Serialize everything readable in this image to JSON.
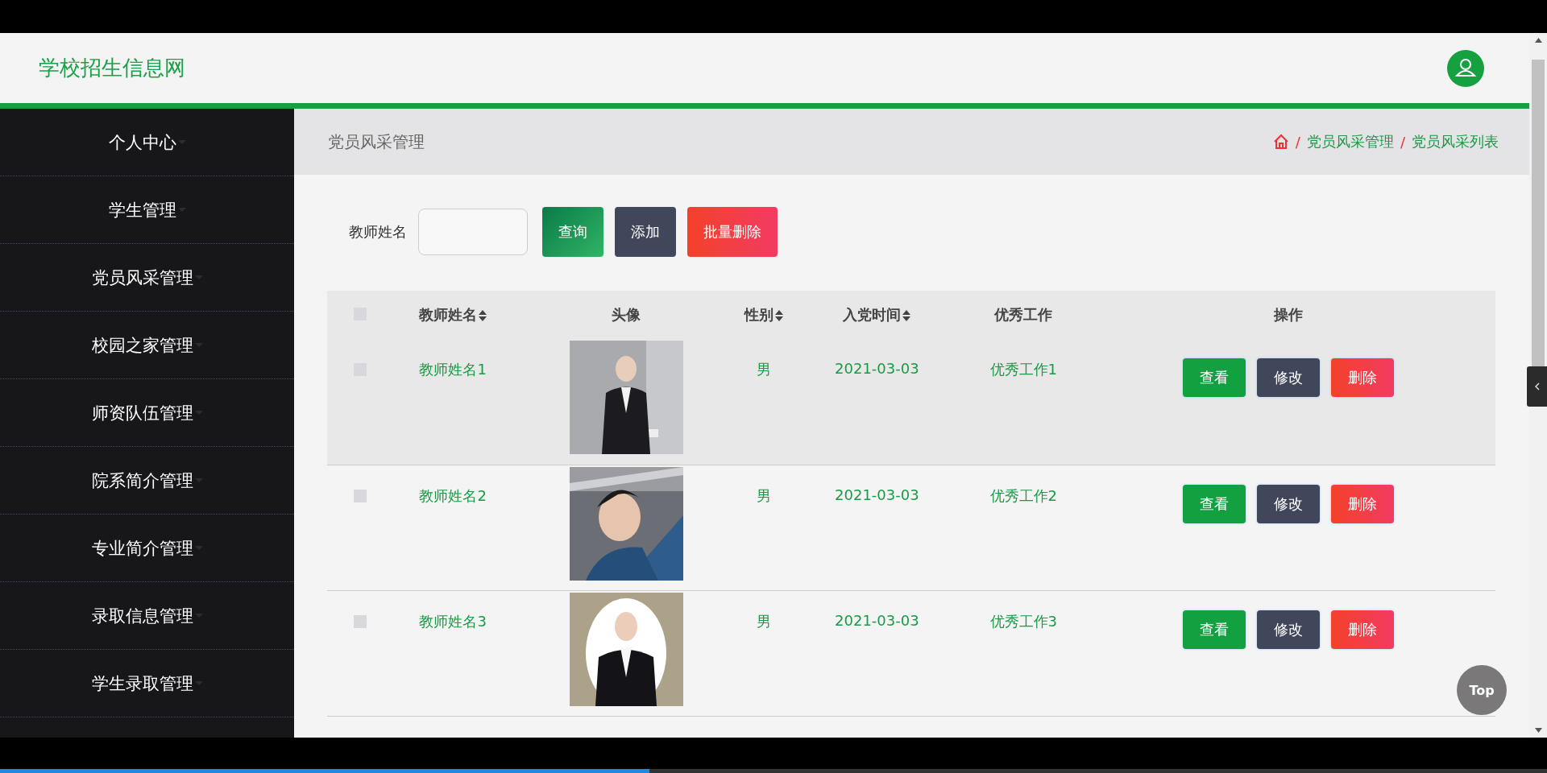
{
  "header": {
    "title": "学校招生信息网"
  },
  "sidebar": {
    "items": [
      {
        "label": "个人中心"
      },
      {
        "label": "学生管理"
      },
      {
        "label": "党员风采管理"
      },
      {
        "label": "校园之家管理"
      },
      {
        "label": "师资队伍管理"
      },
      {
        "label": "院系简介管理"
      },
      {
        "label": "专业简介管理"
      },
      {
        "label": "录取信息管理"
      },
      {
        "label": "学生录取管理"
      }
    ]
  },
  "breadcrumb": {
    "title": "党员风采管理",
    "trail": [
      {
        "separator": "/",
        "label": "党员风采管理"
      },
      {
        "separator": "/",
        "label": "党员风采列表"
      }
    ]
  },
  "search": {
    "label": "教师姓名",
    "buttons": [
      {
        "kind": "query",
        "label": "查询"
      },
      {
        "kind": "add",
        "label": "添加"
      },
      {
        "kind": "delete",
        "label": "批量删除"
      }
    ]
  },
  "table": {
    "header_checkbox": {
      "checked": false
    },
    "columns": [
      {
        "label": "教师姓名",
        "sortable": true
      },
      {
        "label": "头像",
        "sortable": false
      },
      {
        "label": "性别",
        "sortable": true
      },
      {
        "label": "入党时间",
        "sortable": true
      },
      {
        "label": "优秀工作",
        "sortable": false
      },
      {
        "label": "操作",
        "sortable": false
      }
    ],
    "rows": [
      {
        "checked": false,
        "hovered": true,
        "name": "教师姓名1",
        "gender": "男",
        "date": "2021-03-03",
        "work": "优秀工作1",
        "actions": [
          {
            "kind": "view",
            "label": "查看"
          },
          {
            "kind": "edit",
            "label": "修改"
          },
          {
            "kind": "delete",
            "label": "删除"
          }
        ]
      },
      {
        "checked": false,
        "hovered": false,
        "name": "教师姓名2",
        "gender": "男",
        "date": "2021-03-03",
        "work": "优秀工作2",
        "actions": [
          {
            "kind": "view",
            "label": "查看"
          },
          {
            "kind": "edit",
            "label": "修改"
          },
          {
            "kind": "delete",
            "label": "删除"
          }
        ]
      },
      {
        "checked": false,
        "hovered": false,
        "name": "教师姓名3",
        "gender": "男",
        "date": "2021-03-03",
        "work": "优秀工作3",
        "actions": [
          {
            "kind": "view",
            "label": "查看"
          },
          {
            "kind": "edit",
            "label": "修改"
          },
          {
            "kind": "delete",
            "label": "删除"
          }
        ]
      }
    ]
  },
  "back_to_top": {
    "label": "Top"
  },
  "video_progress": {
    "level": 0.42
  }
}
